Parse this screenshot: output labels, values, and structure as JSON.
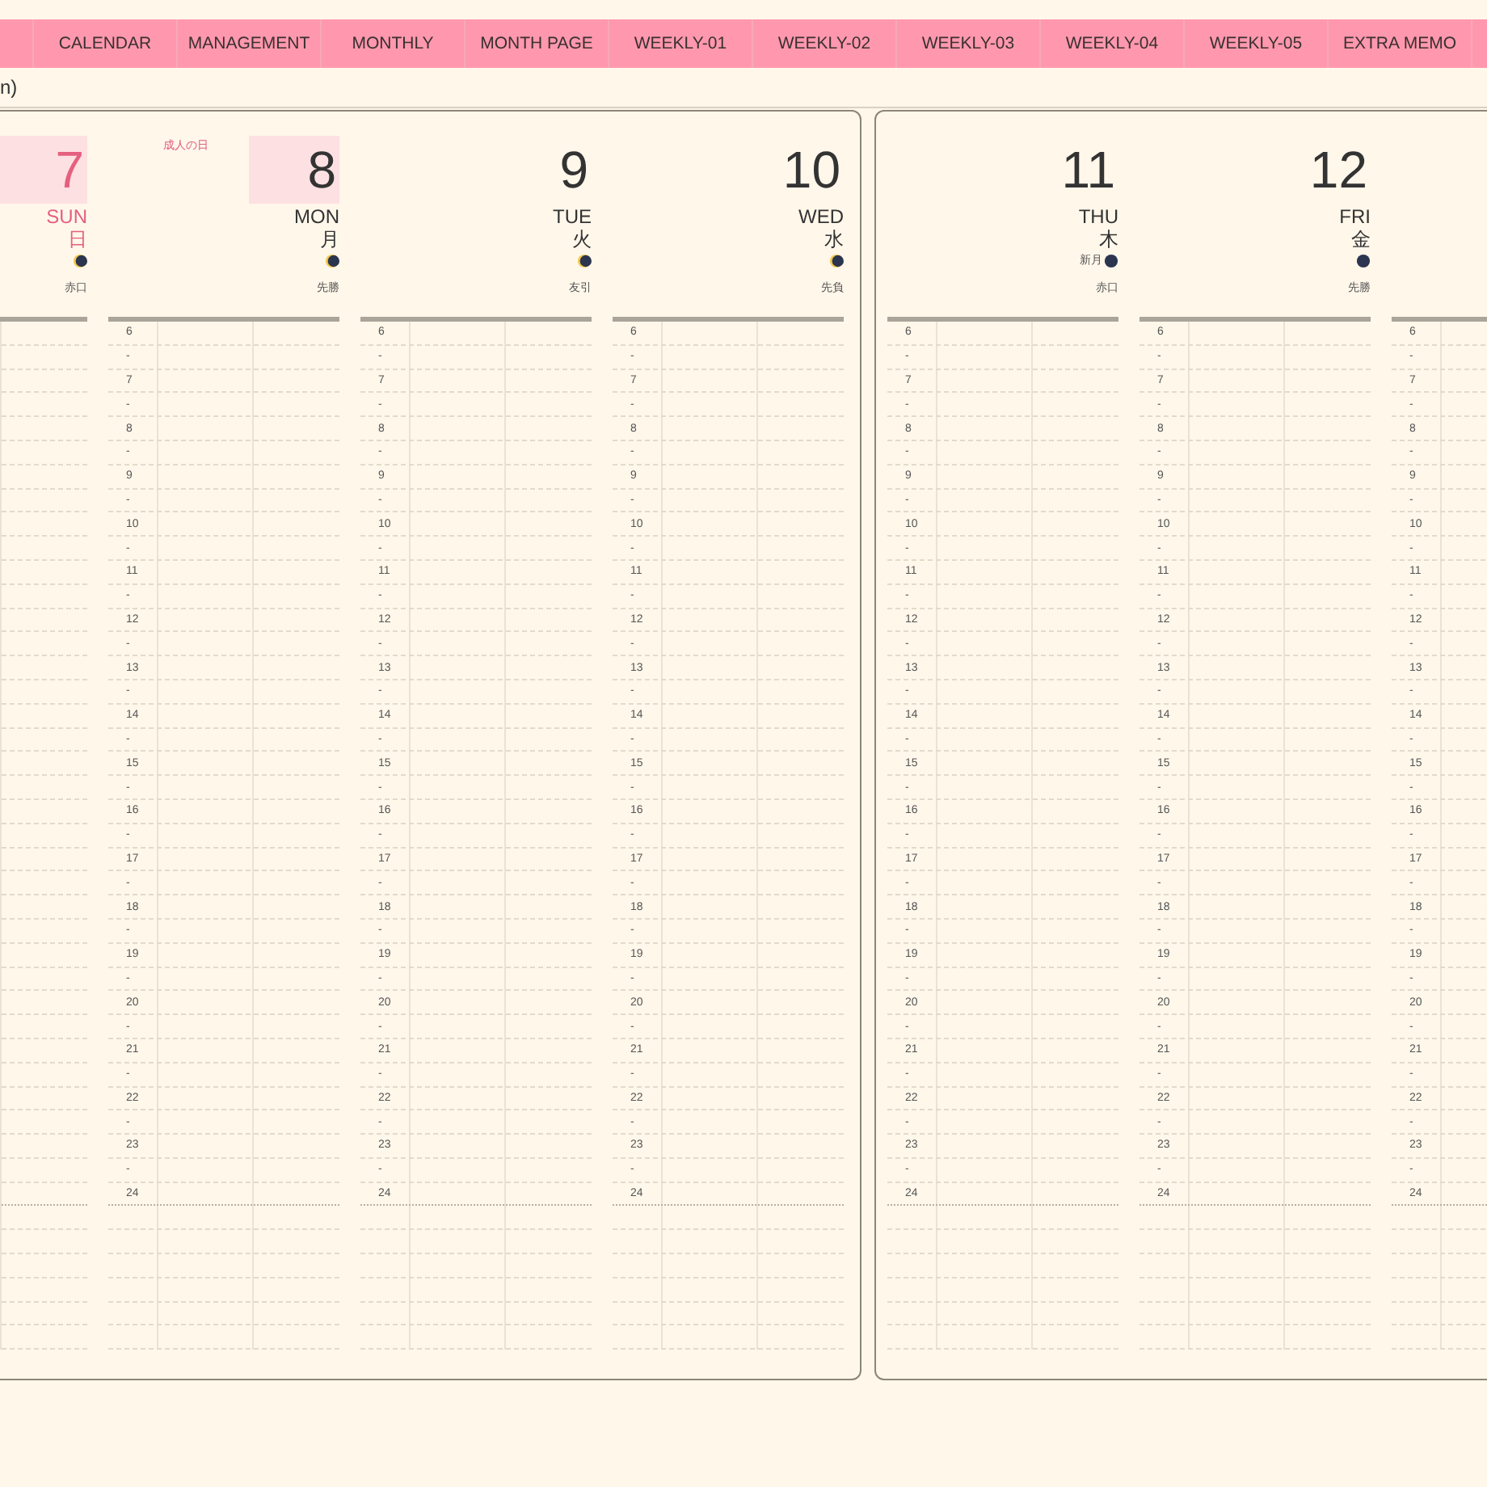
{
  "tabs": [
    {
      "label": "CALENDAR"
    },
    {
      "label": "MANAGEMENT"
    },
    {
      "label": "MONTHLY"
    },
    {
      "label": "MONTH PAGE"
    },
    {
      "label": "WEEKLY-01"
    },
    {
      "label": "WEEKLY-02"
    },
    {
      "label": "WEEKLY-03"
    },
    {
      "label": "WEEKLY-04"
    },
    {
      "label": "WEEKLY-05"
    },
    {
      "label": "EXTRA MEMO"
    }
  ],
  "caption": "n)",
  "pages": [
    {
      "days": [
        {
          "number": "7",
          "weekday": "SUN",
          "kanji": "日",
          "new_moon": false,
          "rokuyo": "赤口",
          "highlighted": true,
          "color": "#e5607f"
        },
        {
          "number": "8",
          "weekday": "MON",
          "kanji": "月",
          "new_moon": false,
          "rokuyo": "先勝",
          "highlighted": true,
          "color": "#333333",
          "holiday": "成人の日",
          "hours": [
            "6",
            "-",
            "7",
            "-",
            "8",
            "-",
            "9",
            "-",
            "10",
            "-",
            "11",
            "-",
            "12",
            "-",
            "13",
            "-",
            "14",
            "-",
            "15",
            "-",
            "16",
            "-",
            "17",
            "-",
            "18",
            "-",
            "19",
            "-",
            "20",
            "-",
            "21",
            "-",
            "22",
            "-",
            "23",
            "-",
            "24"
          ]
        },
        {
          "number": "9",
          "weekday": "TUE",
          "kanji": "火",
          "new_moon": false,
          "rokuyo": "友引",
          "highlighted": false,
          "color": "#333333",
          "hours": [
            "6",
            "-",
            "7",
            "-",
            "8",
            "-",
            "9",
            "-",
            "10",
            "-",
            "11",
            "-",
            "12",
            "-",
            "13",
            "-",
            "14",
            "-",
            "15",
            "-",
            "16",
            "-",
            "17",
            "-",
            "18",
            "-",
            "19",
            "-",
            "20",
            "-",
            "21",
            "-",
            "22",
            "-",
            "23",
            "-",
            "24"
          ]
        },
        {
          "number": "10",
          "weekday": "WED",
          "kanji": "水",
          "new_moon": false,
          "rokuyo": "先負",
          "highlighted": false,
          "color": "#333333",
          "hours": [
            "6",
            "-",
            "7",
            "-",
            "8",
            "-",
            "9",
            "-",
            "10",
            "-",
            "11",
            "-",
            "12",
            "-",
            "13",
            "-",
            "14",
            "-",
            "15",
            "-",
            "16",
            "-",
            "17",
            "-",
            "18",
            "-",
            "19",
            "-",
            "20",
            "-",
            "21",
            "-",
            "22",
            "-",
            "23",
            "-",
            "24"
          ]
        }
      ]
    },
    {
      "days": [
        {
          "number": "11",
          "weekday": "THU",
          "kanji": "木",
          "new_moon": true,
          "moon_label": "新月",
          "rokuyo": "赤口",
          "highlighted": false,
          "color": "#333333",
          "hours": [
            "6",
            "-",
            "7",
            "-",
            "8",
            "-",
            "9",
            "-",
            "10",
            "-",
            "11",
            "-",
            "12",
            "-",
            "13",
            "-",
            "14",
            "-",
            "15",
            "-",
            "16",
            "-",
            "17",
            "-",
            "18",
            "-",
            "19",
            "-",
            "20",
            "-",
            "21",
            "-",
            "22",
            "-",
            "23",
            "-",
            "24"
          ]
        },
        {
          "number": "12",
          "weekday": "FRI",
          "kanji": "金",
          "new_moon": true,
          "rokuyo": "先勝",
          "highlighted": false,
          "color": "#333333",
          "hours": [
            "6",
            "-",
            "7",
            "-",
            "8",
            "-",
            "9",
            "-",
            "10",
            "-",
            "11",
            "-",
            "12",
            "-",
            "13",
            "-",
            "14",
            "-",
            "15",
            "-",
            "16",
            "-",
            "17",
            "-",
            "18",
            "-",
            "19",
            "-",
            "20",
            "-",
            "21",
            "-",
            "22",
            "-",
            "23",
            "-",
            "24"
          ]
        },
        {
          "hours": [
            "6",
            "-",
            "7",
            "-",
            "8",
            "-",
            "9",
            "-",
            "10",
            "-",
            "11",
            "-",
            "12",
            "-",
            "13",
            "-",
            "14",
            "-",
            "15",
            "-",
            "16",
            "-",
            "17",
            "-",
            "18",
            "-",
            "19",
            "-",
            "20",
            "-",
            "21",
            "-",
            "22",
            "-",
            "23",
            "-",
            "24"
          ]
        }
      ]
    }
  ]
}
